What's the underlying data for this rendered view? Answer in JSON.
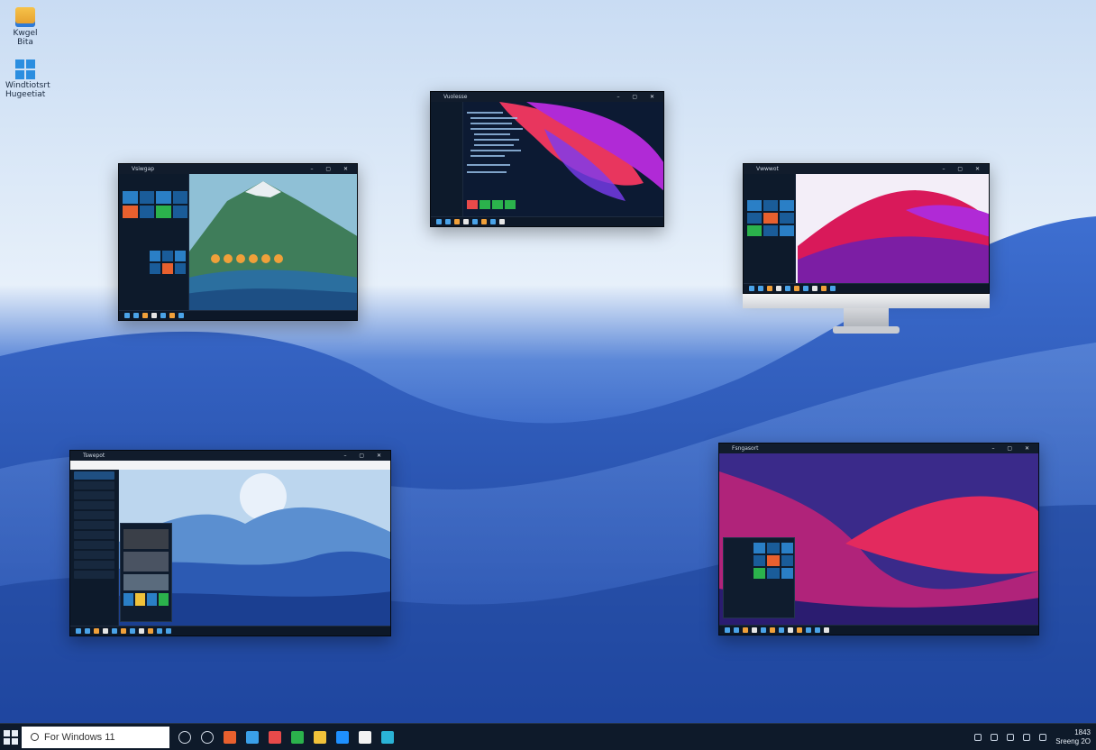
{
  "desktop": {
    "icons": [
      {
        "label": "Kwgel Bita",
        "icon": "folder-icon"
      },
      {
        "label": "Windtiotsrt Hugeetiat",
        "icon": "windows-logo-icon"
      }
    ]
  },
  "windows": {
    "w1": {
      "title": "Vsiwgap",
      "controls": "– ▢ ✕"
    },
    "w2": {
      "title": "Vuolesse",
      "controls": "– ▢ ✕"
    },
    "w3": {
      "title": "Vwwwot",
      "controls": "– ▢ ✕"
    },
    "w4": {
      "title": "Tswepot",
      "controls": "– ▢ ✕"
    },
    "w5": {
      "title": "Fsngasort",
      "controls": "– ▢ ✕"
    }
  },
  "taskbar": {
    "search_text": "For Windows 11",
    "apps": [
      "task-view-icon",
      "chat-icon",
      "office-icon",
      "explorer-icon",
      "mail-icon",
      "messages-icon",
      "files-icon",
      "edge-icon",
      "store-icon",
      "terminal-icon"
    ],
    "app_colors": [
      "#cfd8e4",
      "#cfd8e4",
      "#e8602e",
      "#3aa0e8",
      "#e84a4a",
      "#2bb24c",
      "#f0c23a",
      "#1e90ff",
      "#f2f2f2",
      "#2ab3d6"
    ],
    "clock_line1": "1843",
    "clock_line2": "Sreeng 2O"
  }
}
